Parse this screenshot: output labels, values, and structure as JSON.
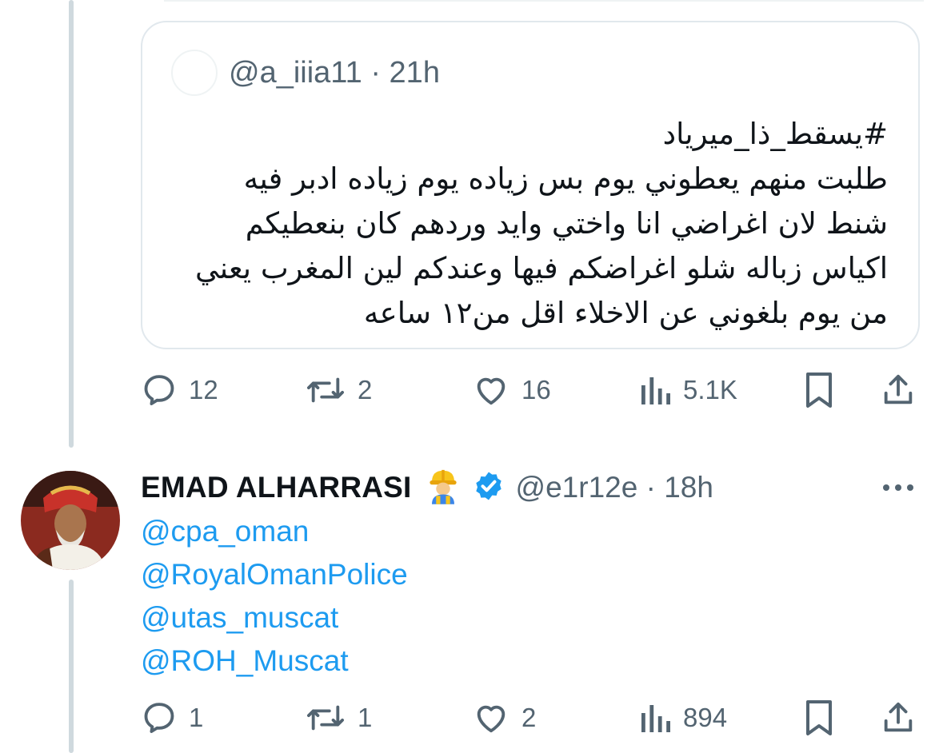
{
  "quoted_tweet": {
    "handle": "@a_iiia11",
    "separator": "·",
    "time": "21h",
    "lines": [
      "#يسقط_ذا_ميرياد",
      "طلبت منهم يعطوني يوم بس زياده يوم زياده ادبر فيه",
      "شنط لان اغراضي انا واختي وايد وردهم كان بنعطيكم",
      "اكياس زباله شلو اغراضكم فيها وعندكم لين المغرب يعني",
      "من يوم بلغوني عن الاخلاء اقل من١٢ ساعه"
    ]
  },
  "tweet_actions": {
    "replies": "12",
    "reposts": "2",
    "likes": "16",
    "views": "5.1K"
  },
  "reply_tweet": {
    "display_name": "EMAD ALHARRASI",
    "emoji": "construction-worker-emoji",
    "verified_color": "#1d9bf0",
    "handle": "@e1r12e",
    "separator": "·",
    "time": "18h",
    "mentions": [
      "@cpa_oman",
      "@RoyalOmanPolice",
      "@utas_muscat",
      "@ROH_Muscat"
    ]
  },
  "reply_actions": {
    "replies": "1",
    "reposts": "1",
    "likes": "2",
    "views": "894"
  },
  "colors": {
    "text": "#0f1419",
    "muted": "#536471",
    "link": "#1d9bf0",
    "border": "#e1e8ed",
    "thread_line": "#cfd9de"
  }
}
